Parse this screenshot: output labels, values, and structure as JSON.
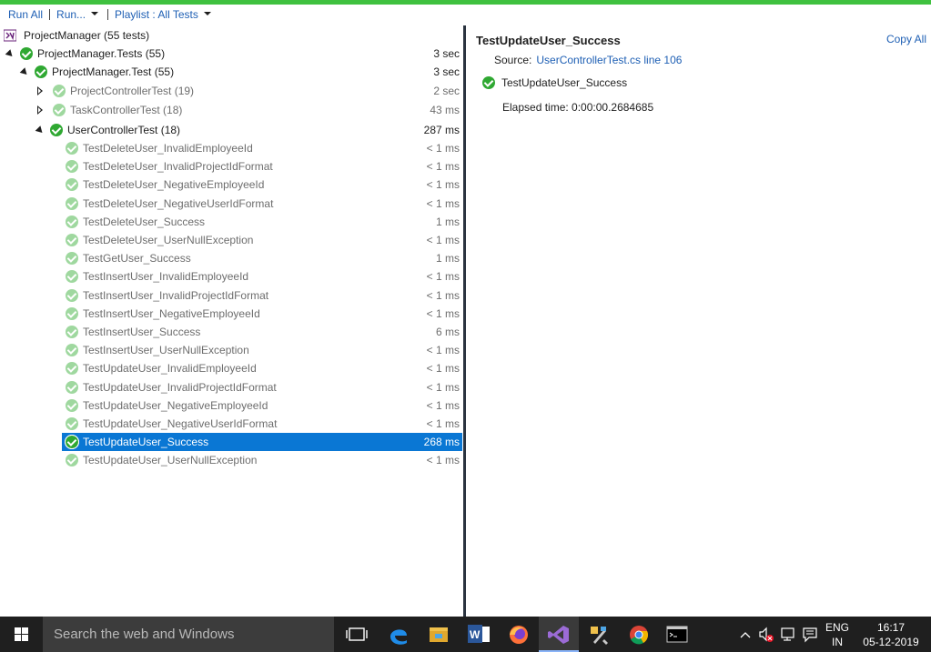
{
  "toolbar": {
    "run_all": "Run All",
    "run": "Run...",
    "playlist": "Playlist : All Tests"
  },
  "tree": {
    "root": {
      "label": "ProjectManager (55 tests)"
    },
    "project": {
      "label": "ProjectManager.Tests (55)",
      "duration": "3 sec"
    },
    "namespace": {
      "label": "ProjectManager.Test (55)",
      "duration": "3 sec"
    },
    "classes": [
      {
        "label": "ProjectControllerTest (19)",
        "duration": "2 sec"
      },
      {
        "label": "TaskControllerTest (18)",
        "duration": "43 ms"
      },
      {
        "label": "UserControllerTest (18)",
        "duration": "287 ms"
      }
    ],
    "tests": [
      {
        "label": "TestDeleteUser_InvalidEmployeeId",
        "duration": "< 1 ms"
      },
      {
        "label": "TestDeleteUser_InvalidProjectIdFormat",
        "duration": "< 1 ms"
      },
      {
        "label": "TestDeleteUser_NegativeEmployeeId",
        "duration": "< 1 ms"
      },
      {
        "label": "TestDeleteUser_NegativeUserIdFormat",
        "duration": "< 1 ms"
      },
      {
        "label": "TestDeleteUser_Success",
        "duration": "1 ms"
      },
      {
        "label": "TestDeleteUser_UserNullException",
        "duration": "< 1 ms"
      },
      {
        "label": "TestGetUser_Success",
        "duration": "1 ms"
      },
      {
        "label": "TestInsertUser_InvalidEmployeeId",
        "duration": "< 1 ms"
      },
      {
        "label": "TestInsertUser_InvalidProjectIdFormat",
        "duration": "< 1 ms"
      },
      {
        "label": "TestInsertUser_NegativeEmployeeId",
        "duration": "< 1 ms"
      },
      {
        "label": "TestInsertUser_Success",
        "duration": "6 ms"
      },
      {
        "label": "TestInsertUser_UserNullException",
        "duration": "< 1 ms"
      },
      {
        "label": "TestUpdateUser_InvalidEmployeeId",
        "duration": "< 1 ms"
      },
      {
        "label": "TestUpdateUser_InvalidProjectIdFormat",
        "duration": "< 1 ms"
      },
      {
        "label": "TestUpdateUser_NegativeEmployeeId",
        "duration": "< 1 ms"
      },
      {
        "label": "TestUpdateUser_NegativeUserIdFormat",
        "duration": "< 1 ms"
      },
      {
        "label": "TestUpdateUser_Success",
        "duration": "268 ms"
      },
      {
        "label": "TestUpdateUser_UserNullException",
        "duration": "< 1 ms"
      }
    ]
  },
  "detail": {
    "title": "TestUpdateUser_Success",
    "copy_all": "Copy All",
    "source_label": "Source:",
    "source_link": "UserControllerTest.cs line 106",
    "result_name": "TestUpdateUser_Success",
    "elapsed": "Elapsed time: 0:00:00.2684685"
  },
  "taskbar": {
    "search_placeholder": "Search the web and Windows",
    "lang_top": "ENG",
    "lang_bottom": "IN",
    "time": "16:17",
    "date": "05-12-2019",
    "apps": [
      "task-view-icon",
      "edge-icon",
      "file-explorer-icon",
      "word-icon",
      "firefox-icon",
      "visual-studio-icon",
      "tools-icon",
      "chrome-icon",
      "command-prompt-icon"
    ]
  },
  "colors": {
    "accent_green": "#3fc13f",
    "pass_green": "#2fa832",
    "selection_blue": "#0a77d4",
    "link_blue": "#1e5fb4"
  }
}
